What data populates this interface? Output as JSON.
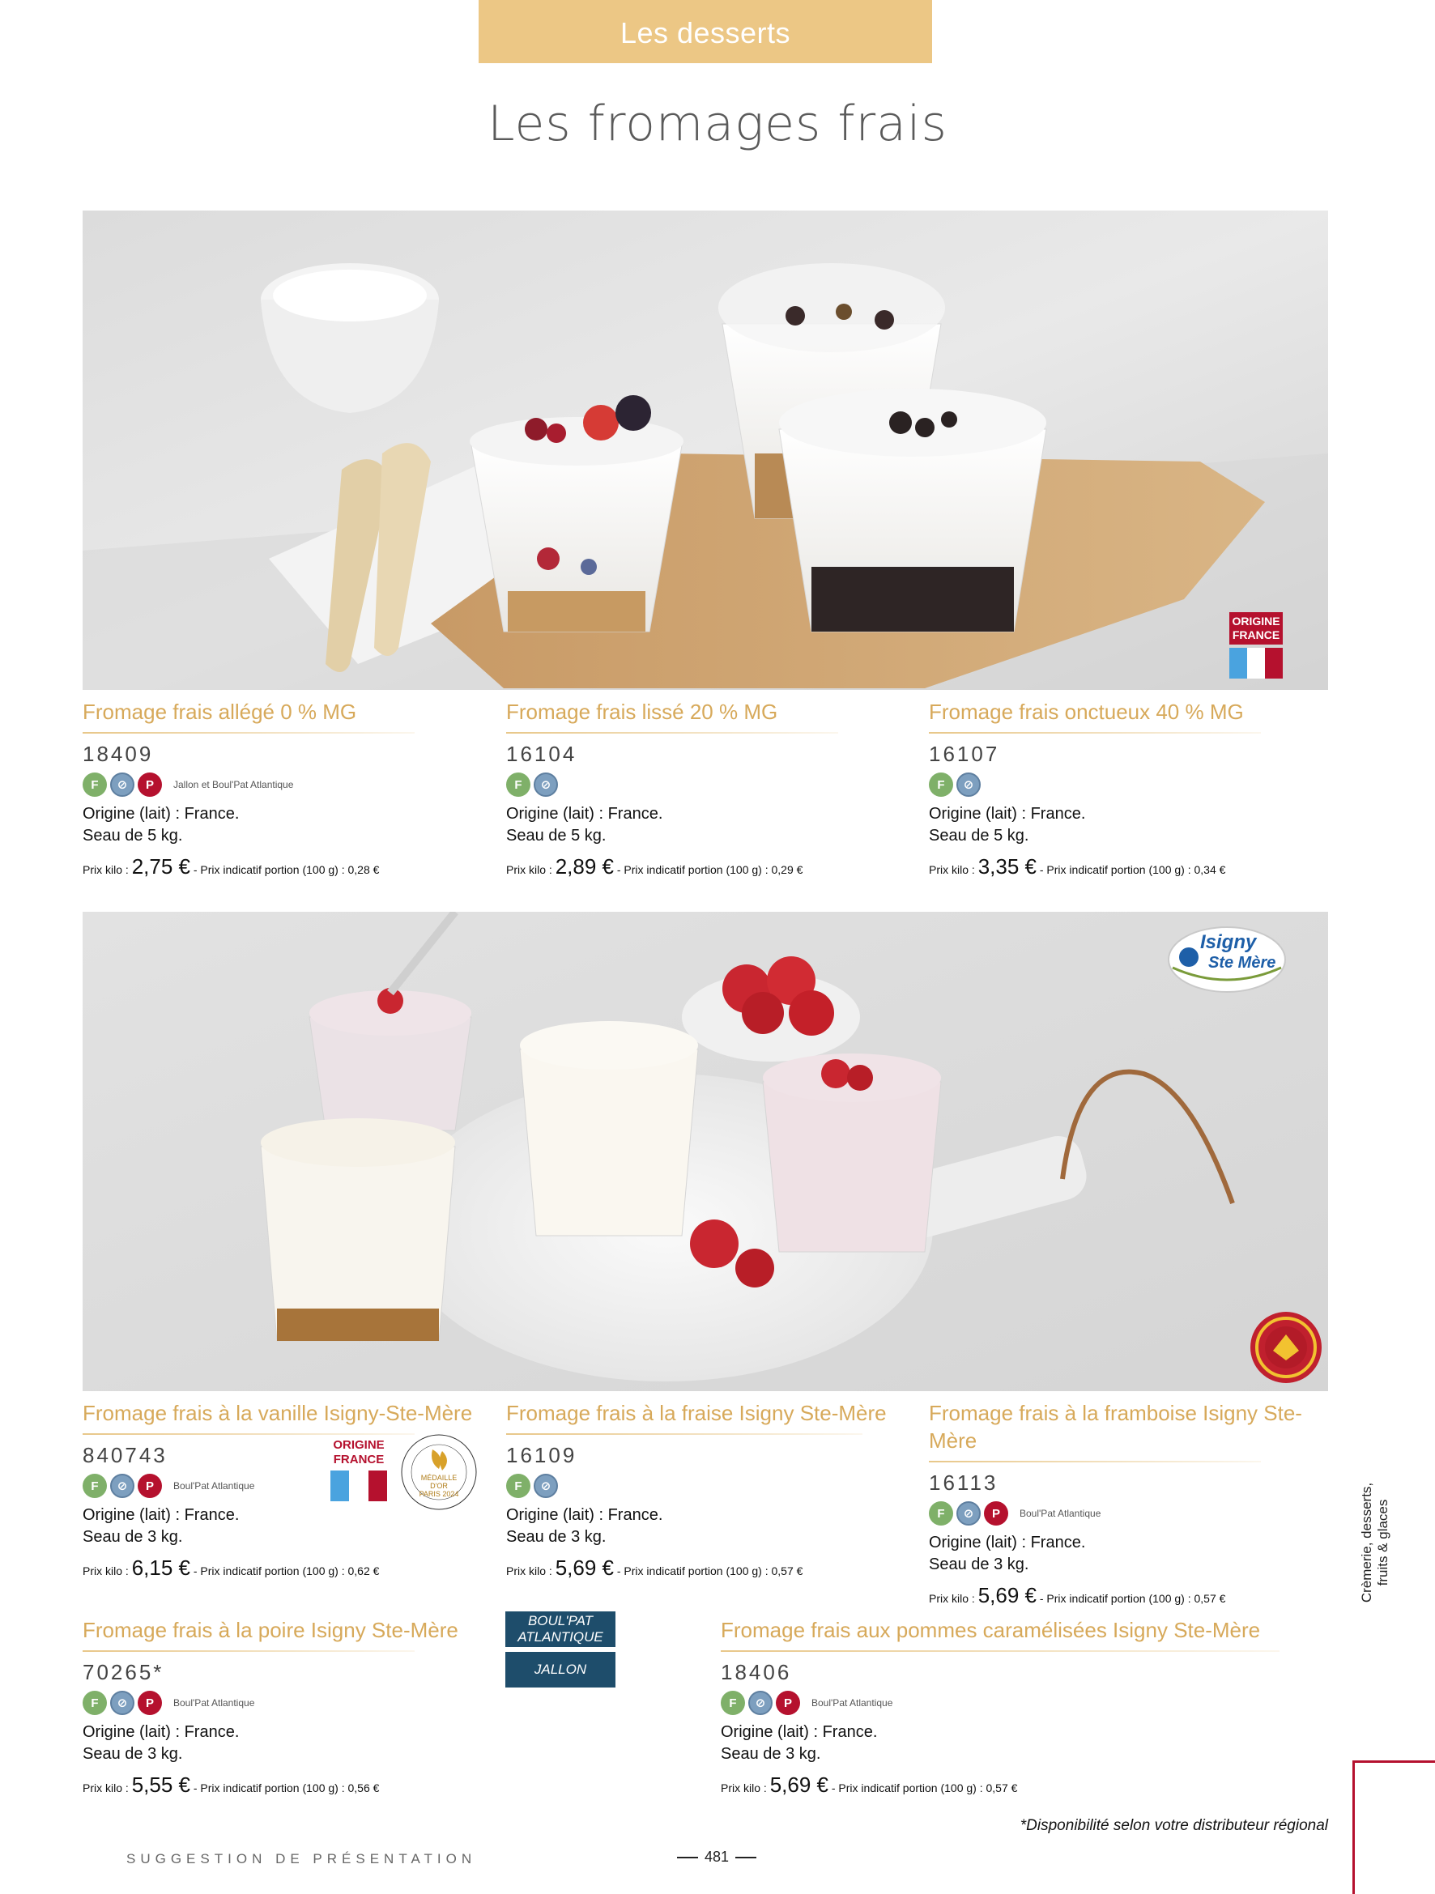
{
  "header": {
    "section_tab": "Les desserts",
    "title": "Les fromages frais"
  },
  "badges": {
    "f": "F",
    "p": "P"
  },
  "products_top": [
    {
      "title": "Fromage frais allégé 0 % MG",
      "code": "18409",
      "badges": [
        "f",
        "s",
        "p"
      ],
      "distributor": "Jallon et Boul'Pat Atlantique",
      "origin": "Origine (lait) : France.",
      "pack": "Seau de 5 kg.",
      "price_prefix": "Prix kilo : ",
      "price": "2,75 €",
      "price_suffix": " - Prix indicatif portion (100 g) : 0,28 €"
    },
    {
      "title": "Fromage frais lissé 20 % MG",
      "code": "16104",
      "badges": [
        "f",
        "s"
      ],
      "distributor": "",
      "origin": "Origine (lait) : France.",
      "pack": "Seau de 5 kg.",
      "price_prefix": "Prix kilo : ",
      "price": "2,89 €",
      "price_suffix": " - Prix indicatif portion (100 g) : 0,29 €"
    },
    {
      "title": "Fromage frais onctueux 40 % MG",
      "code": "16107",
      "badges": [
        "f",
        "s"
      ],
      "distributor": "",
      "origin": "Origine (lait) : France.",
      "pack": "Seau de 5 kg.",
      "price_prefix": "Prix kilo : ",
      "price": "3,35 €",
      "price_suffix": " - Prix indicatif portion (100 g) : 0,34 €"
    }
  ],
  "products_bottom": [
    {
      "title": "Fromage frais à la vanille Isigny-Ste-Mère",
      "code": "840743",
      "badges": [
        "f",
        "s",
        "p"
      ],
      "distributor": "Boul'Pat Atlantique",
      "origin": "Origine (lait) : France.",
      "pack": "Seau de 3 kg.",
      "price_prefix": "Prix kilo : ",
      "price": "6,15 €",
      "price_suffix": " - Prix indicatif portion (100 g) : 0,62 €"
    },
    {
      "title": "Fromage frais à la fraise Isigny Ste-Mère",
      "code": "16109",
      "badges": [
        "f",
        "s"
      ],
      "distributor": "",
      "origin": "Origine (lait) : France.",
      "pack": "Seau de 3 kg.",
      "price_prefix": "Prix kilo : ",
      "price": "5,69 €",
      "price_suffix": " - Prix indicatif portion (100 g) : 0,57 €"
    },
    {
      "title": "Fromage frais à la framboise Isigny Ste-Mère",
      "code": "16113",
      "badges": [
        "f",
        "s",
        "p"
      ],
      "distributor": "Boul'Pat Atlantique",
      "origin": "Origine (lait) : France.",
      "pack": "Seau de 3 kg.",
      "price_prefix": "Prix kilo : ",
      "price": "5,69 €",
      "price_suffix": " - Prix indicatif portion (100 g) : 0,57 €"
    },
    {
      "title": "Fromage frais à la poire Isigny Ste-Mère",
      "code": "70265*",
      "badges": [
        "f",
        "s",
        "p"
      ],
      "distributor": "Boul'Pat Atlantique",
      "origin": "Origine (lait) : France.",
      "pack": "Seau de 3 kg.",
      "price_prefix": "Prix kilo : ",
      "price": "5,55 €",
      "price_suffix": " - Prix indicatif portion (100 g) : 0,56 €"
    },
    {
      "title": "Fromage frais aux pommes caramélisées Isigny Ste-Mère",
      "code": "18406",
      "badges": [
        "f",
        "s",
        "p"
      ],
      "distributor": "Boul'Pat Atlantique",
      "origin": "Origine (lait) : France.",
      "pack": "Seau de 3 kg.",
      "price_prefix": "Prix kilo : ",
      "price": "5,69 €",
      "price_suffix": " - Prix indicatif portion (100 g) : 0,57 €"
    }
  ],
  "origine_badge": {
    "line1": "ORIGINE",
    "line2": "FRANCE"
  },
  "isigny_logo": {
    "line1": "Isigny",
    "line2": "Ste Mère"
  },
  "aop_seal": "APPELLATION D'ORIGINE PROTÉGÉE",
  "medal": {
    "line1": "MÉDAILLE",
    "line2": "D'OR",
    "line3": "PARIS 2024",
    "ring": "CONCOURS GÉNÉRAL AGRICOLE"
  },
  "distributors_legend": {
    "boulpat": "BOUL'PAT ATLANTIQUE",
    "jallon": "JALLON"
  },
  "side_tab": "Crèmerie, desserts, fruits & glaces",
  "footnote": "*Disponibilité selon votre distributeur régional",
  "footer": {
    "suggestion": "SUGGESTION DE PRÉSENTATION",
    "page_number": "481"
  }
}
